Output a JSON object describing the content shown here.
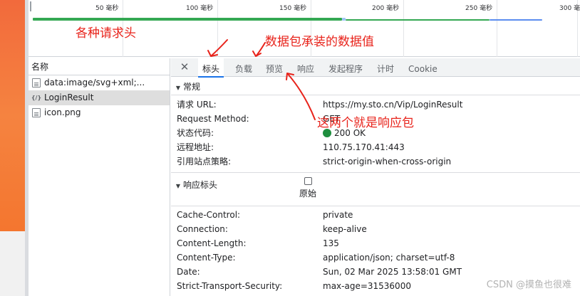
{
  "timeline": {
    "ticks": [
      {
        "value": "50",
        "unit": "毫秒"
      },
      {
        "value": "100",
        "unit": "毫秒"
      },
      {
        "value": "150",
        "unit": "毫秒"
      },
      {
        "value": "200",
        "unit": "毫秒"
      },
      {
        "value": "250",
        "unit": "毫秒"
      },
      {
        "value": "300",
        "unit": "毫秒"
      }
    ]
  },
  "names_panel": {
    "header": "名称",
    "rows": [
      {
        "label": "data:image/svg+xml;...",
        "icon": "document-icon",
        "selected": false
      },
      {
        "label": "LoginResult",
        "icon": "code-braces-icon",
        "selected": true
      },
      {
        "label": "icon.png",
        "icon": "document-icon",
        "selected": false
      }
    ]
  },
  "details": {
    "close_label": "✕",
    "tabs": [
      {
        "label": "标头",
        "active": true
      },
      {
        "label": "负载",
        "active": false
      },
      {
        "label": "预览",
        "active": false
      },
      {
        "label": "响应",
        "active": false
      },
      {
        "label": "发起程序",
        "active": false
      },
      {
        "label": "计时",
        "active": false
      },
      {
        "label": "Cookie",
        "active": false
      }
    ],
    "general": {
      "title": "常规",
      "rows": [
        {
          "key": "请求 URL:",
          "value": "https://my.sto.cn/Vip/LoginResult"
        },
        {
          "key": "Request Method:",
          "value": "GET"
        },
        {
          "key": "状态代码:",
          "value": "200 OK"
        },
        {
          "key": "远程地址:",
          "value": "110.75.170.41:443"
        },
        {
          "key": "引用站点策略:",
          "value": "strict-origin-when-cross-origin"
        }
      ]
    },
    "response_headers": {
      "title": "响应标头",
      "raw_label": "原始",
      "rows": [
        {
          "key": "Cache-Control:",
          "value": "private"
        },
        {
          "key": "Connection:",
          "value": "keep-alive"
        },
        {
          "key": "Content-Length:",
          "value": "135"
        },
        {
          "key": "Content-Type:",
          "value": "application/json; charset=utf-8"
        },
        {
          "key": "Date:",
          "value": "Sun, 02 Mar 2025 13:58:01 GMT"
        },
        {
          "key": "Strict-Transport-Security:",
          "value": "max-age=31536000"
        }
      ]
    }
  },
  "annotations": {
    "request_headers": "各种请求头",
    "payload_values": "数据包承装的数据值",
    "response_packets": "这两个就是响应包",
    "color": "#e8231b"
  },
  "watermark": "CSDN @摸鱼也很难",
  "colors": {
    "accent": "#1a73e8",
    "status_ok": "#1e8e3e",
    "page_orange": "#f4762f",
    "timeline_green": "#34a853"
  }
}
